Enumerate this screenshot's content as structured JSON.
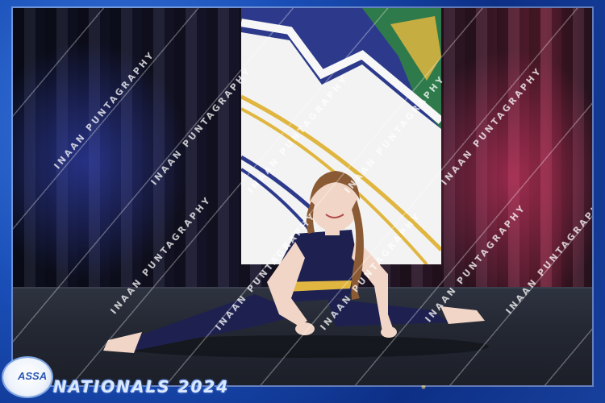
{
  "event": {
    "logo_text": "ASSA",
    "title": "NATIONALS 2024"
  },
  "watermark": {
    "text": "INAAN PUNTAGRAPHY"
  },
  "colors": {
    "frame_blue": "#1a4fb8",
    "costume_navy": "#1e2150",
    "banner_gold": "#e0b640",
    "banner_green": "#2f7a4a"
  },
  "icons": {
    "logo": "assa-logo-icon",
    "dancer": "dancer-photo"
  }
}
